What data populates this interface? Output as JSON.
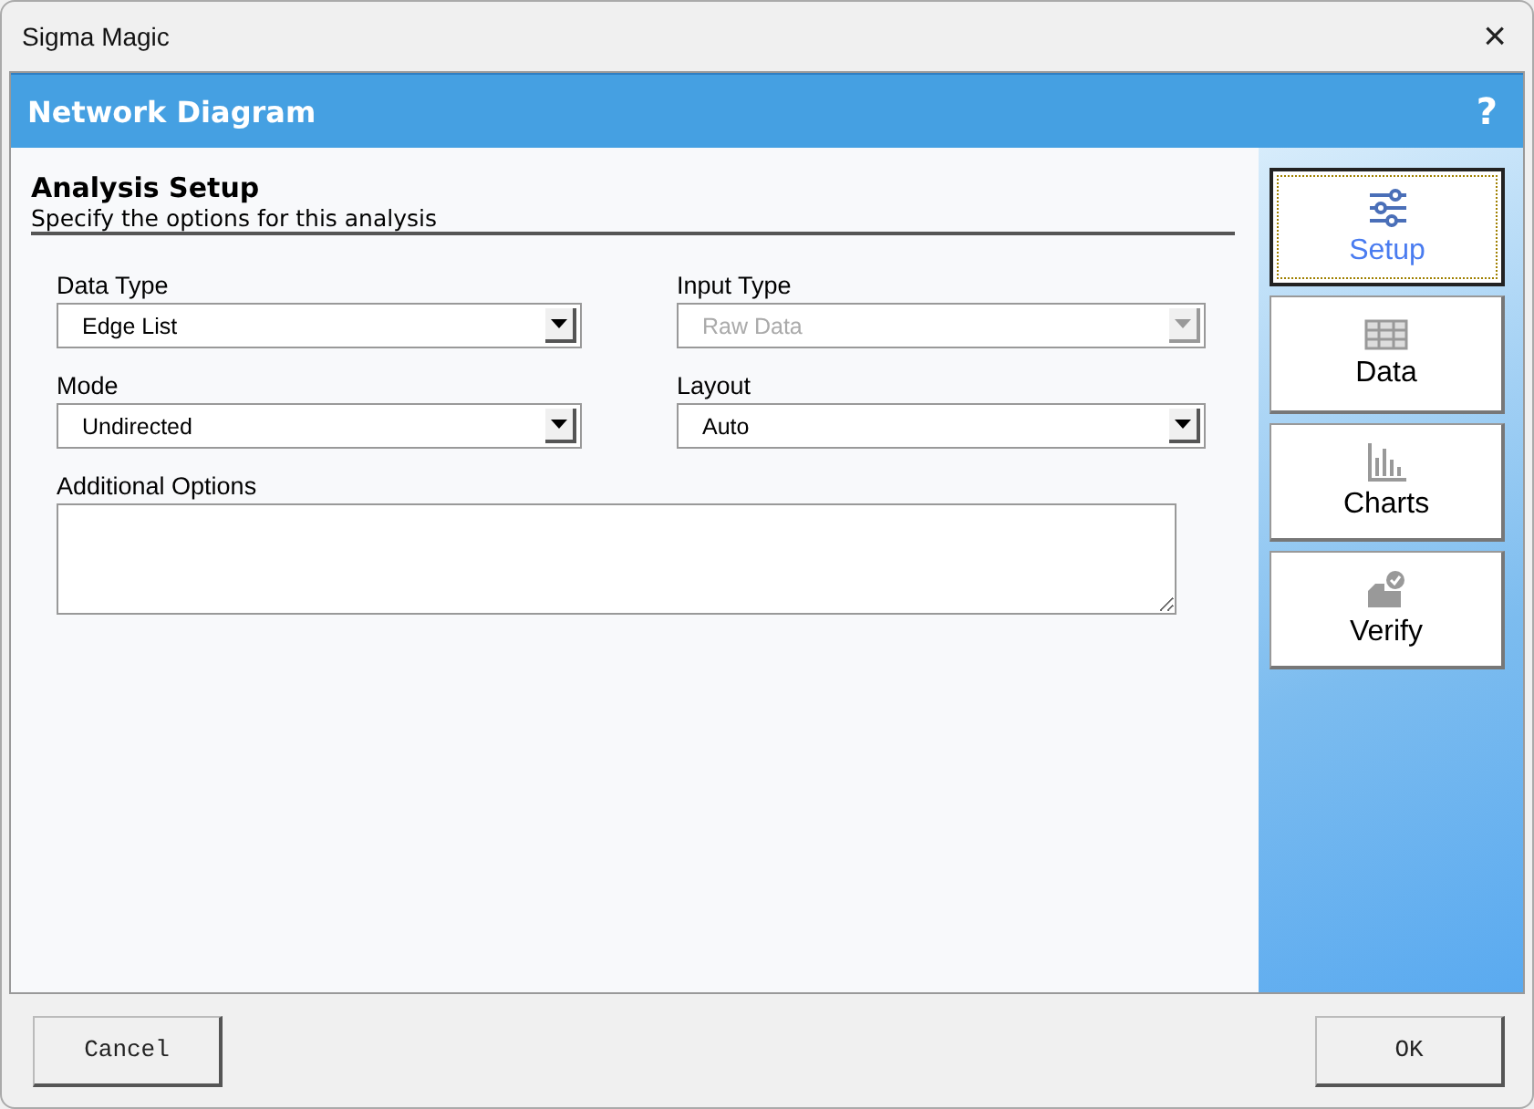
{
  "window": {
    "title": "Sigma Magic",
    "close": "×"
  },
  "header": {
    "title": "Network Diagram",
    "help": "?"
  },
  "section": {
    "title": "Analysis Setup",
    "subtitle": "Specify the options for this analysis"
  },
  "fields": [
    {
      "label": "Data Type",
      "value": "Edge List",
      "disabled": false
    },
    {
      "label": "Input Type",
      "value": "Raw Data",
      "disabled": true
    },
    {
      "label": "Mode",
      "value": "Undirected",
      "disabled": false
    },
    {
      "label": "Layout",
      "value": "Auto",
      "disabled": false
    }
  ],
  "additional_options": {
    "label": "Additional Options"
  },
  "nav": [
    {
      "label": "Setup",
      "kind": "sliders",
      "selected": true
    },
    {
      "label": "Data",
      "kind": "table",
      "selected": false
    },
    {
      "label": "Charts",
      "kind": "bars",
      "selected": false
    },
    {
      "label": "Verify",
      "kind": "inbox",
      "selected": false
    }
  ],
  "cancel_button": {
    "label": "Cancel"
  },
  "ok_button": {
    "label": "OK"
  }
}
